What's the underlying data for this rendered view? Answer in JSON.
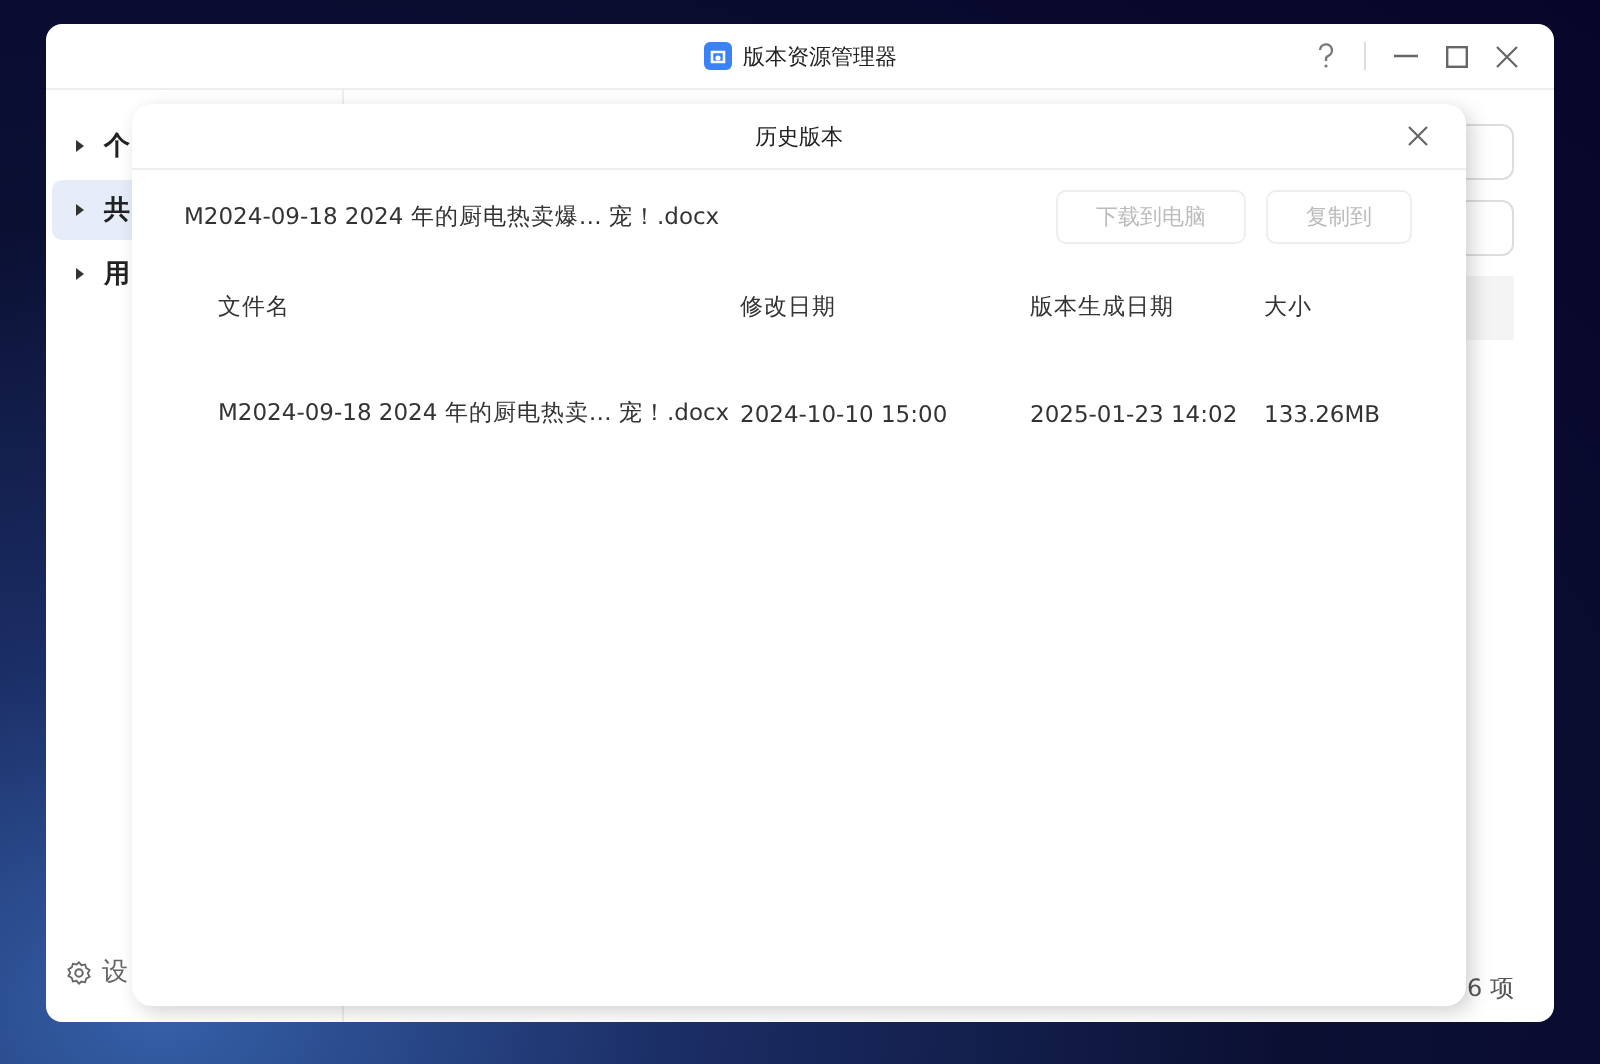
{
  "window": {
    "title": "版本资源管理器"
  },
  "sidebar": {
    "items": [
      {
        "label": "个",
        "selected": false
      },
      {
        "label": "共",
        "selected": true
      },
      {
        "label": "用",
        "selected": false
      }
    ],
    "settings": "设"
  },
  "status_bar": {
    "count": "6 项"
  },
  "dialog": {
    "title": "历史版本",
    "file_name": "M2024-09-18 2024 年的厨电热卖爆… 宠！.docx",
    "buttons": [
      {
        "label": "下载到电脑",
        "disabled": true
      },
      {
        "label": "复制到",
        "disabled": true
      }
    ],
    "table": {
      "columns": [
        "文件名",
        "修改日期",
        "版本生成日期",
        "大小"
      ],
      "rows": [
        [
          "M2024-09-18 2024 年的厨电热卖…  宠！.docx",
          "2024-10-10 15:00",
          "2025-01-23 14:02",
          "133.26MB"
        ]
      ]
    }
  }
}
